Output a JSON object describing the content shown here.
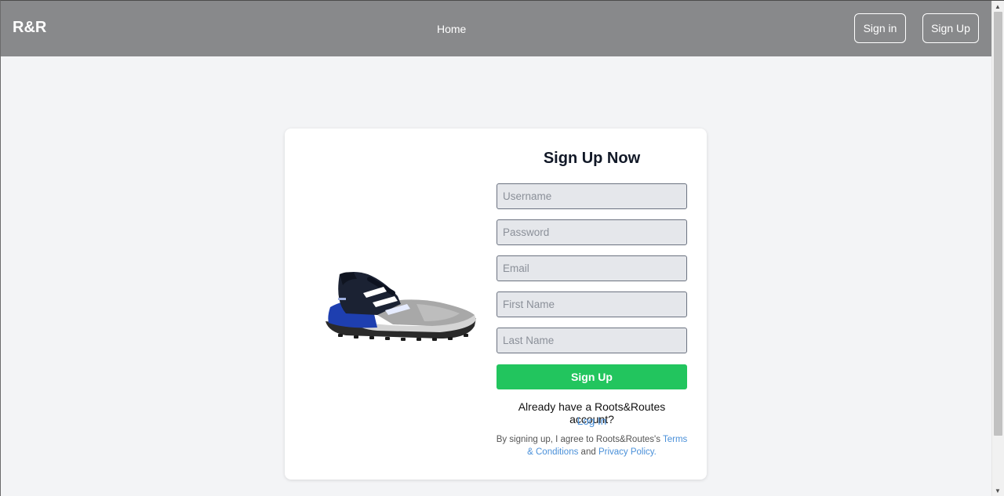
{
  "header": {
    "brand": "R&R",
    "home": "Home",
    "signin": "Sign in",
    "signup": "Sign Up"
  },
  "form": {
    "title": "Sign Up Now",
    "fields": {
      "username": "Username",
      "password": "Password",
      "email": "Email",
      "first_name": "First Name",
      "last_name": "Last Name"
    },
    "submit": "Sign Up",
    "already": "Already have a Roots&Routes account?",
    "login": "Log In",
    "terms_prefix": "By signing up, I agree to Roots&Routes's ",
    "terms_link": "Terms & Conditions",
    "terms_and": " and ",
    "privacy_link": "Privacy Policy."
  },
  "colors": {
    "nav_bg": "#88898b",
    "page_bg": "#f3f4f6",
    "submit_bg": "#22c55e",
    "link": "#4a90d9"
  },
  "icons": {
    "product_image": "trail-running-shoe-image"
  }
}
